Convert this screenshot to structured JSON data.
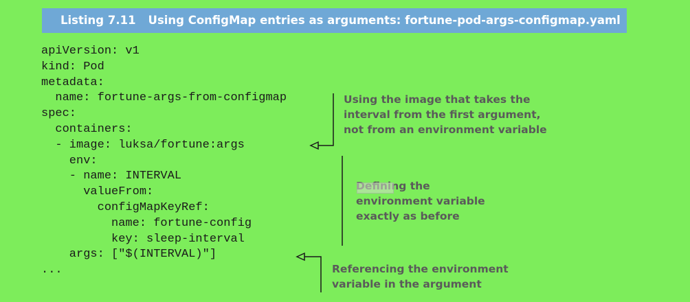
{
  "listing": {
    "number": "Listing 7.11",
    "title": "Using ConfigMap entries as arguments: fortune-pod-args-configmap.yaml"
  },
  "code_lines": [
    "apiVersion: v1",
    "kind: Pod",
    "metadata:",
    "  name: fortune-args-from-configmap",
    "spec:",
    "  containers:",
    "  - image: luksa/fortune:args",
    "    env:",
    "    - name: INTERVAL",
    "      valueFrom:",
    "        configMapKeyRef:",
    "          name: fortune-config",
    "          key: sleep-interval",
    "    args: [\"$(INTERVAL)\"]",
    "..."
  ],
  "callouts": {
    "image": [
      "Using the image that takes the",
      "interval from the first argument,",
      "not from an environment variable"
    ],
    "env": [
      "Defining the",
      "environment variable",
      "exactly as before"
    ],
    "args": [
      "Referencing the environment",
      "variable in the argument"
    ]
  },
  "colors": {
    "background": "#7ded5b",
    "header_bar": "#6fa8d6",
    "header_text": "#ffffff",
    "code_text": "#1a1a1a",
    "callout_text": "#5a5a5a"
  }
}
